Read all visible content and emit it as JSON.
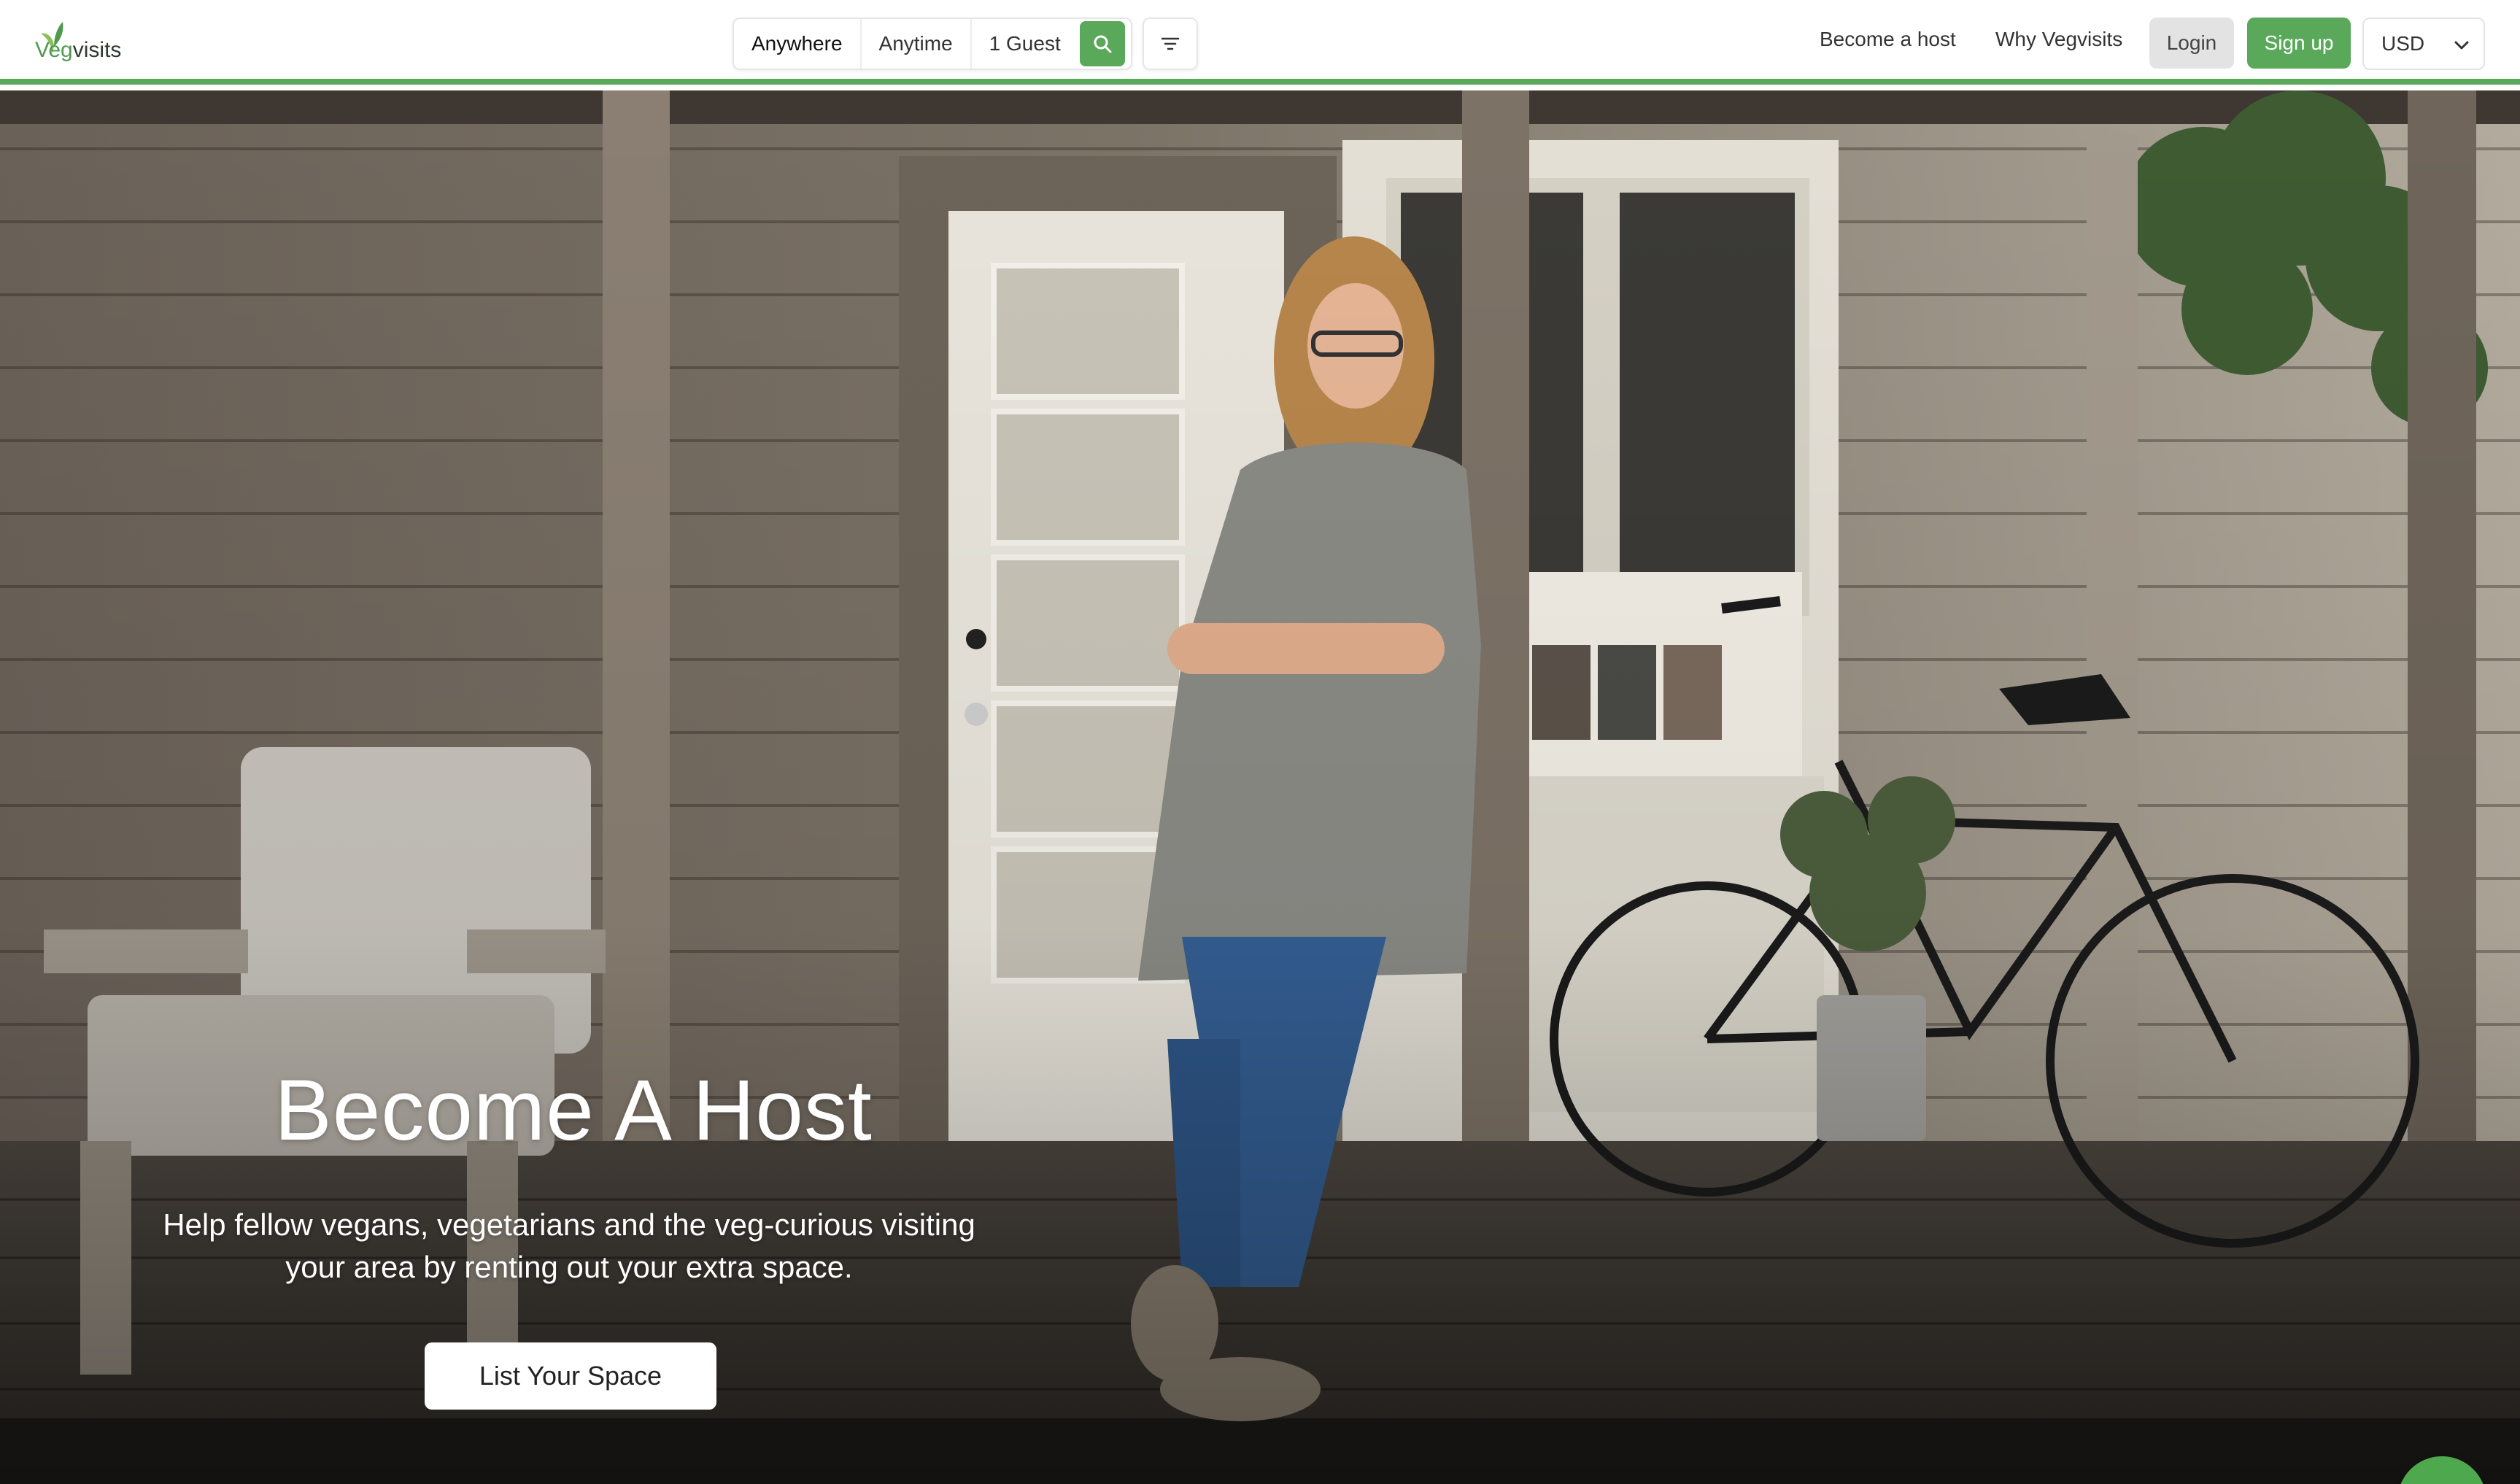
{
  "brand": {
    "logo_text_accent": "Veg",
    "logo_text_rest": "visits",
    "brand_color": "#5aa85a"
  },
  "search": {
    "location": "Anywhere",
    "dates": "Anytime",
    "guests": "1 Guest",
    "search_icon": "search-icon",
    "filter_icon": "filter-icon"
  },
  "nav": {
    "become_host": "Become a host",
    "why": "Why Vegvisits",
    "login": "Login",
    "signup": "Sign up",
    "currency": "USD"
  },
  "hero": {
    "title": "Become A Host",
    "subtitle": "Help fellow vegans, vegetarians and the veg-curious visiting your area by renting out your extra space.",
    "cta": "List Your Space"
  },
  "chat": {
    "icon": "chat-icon"
  }
}
